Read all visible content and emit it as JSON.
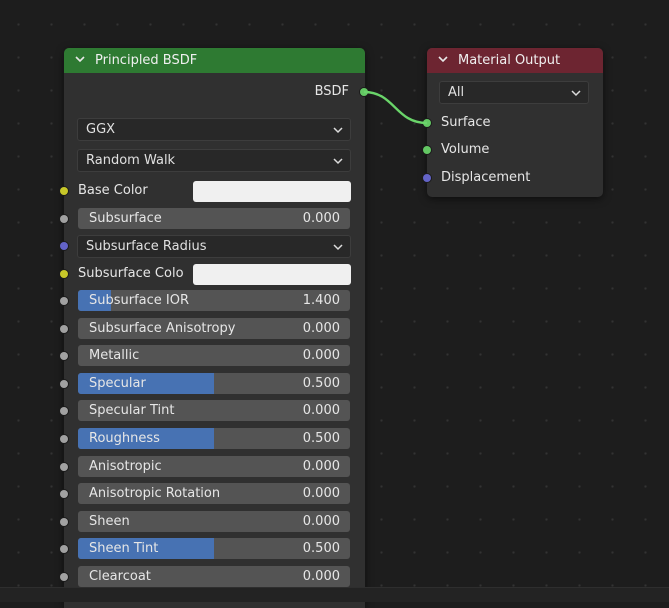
{
  "colors": {
    "bsdf_header": "#2e7a32",
    "output_header": "#6d2531",
    "slider_fill": "#4772b3",
    "slider_bg": "#545454",
    "socket_yellow": "#c7c729",
    "socket_gray": "#a1a1a1",
    "socket_blue": "#6363c7",
    "socket_green": "#63c763",
    "link": "#6ad56a"
  },
  "bsdf_node": {
    "title": "Principled BSDF",
    "output_label": "BSDF",
    "distribution": "GGX",
    "subsurface_method": "Random Walk",
    "base_color_label": "Base Color",
    "base_color_value": "#f0f0f0",
    "subsurface_radius_label": "Subsurface Radius",
    "subsurface_color_label": "Subsurface Colo",
    "subsurface_color_value": "#f0f0f0",
    "sliders": [
      {
        "label": "Subsurface",
        "value": "0.000",
        "fill": 0.0
      },
      {
        "label": "Subsurface IOR",
        "value": "1.400",
        "fill": 0.12
      },
      {
        "label": "Subsurface Anisotropy",
        "value": "0.000",
        "fill": 0.0
      },
      {
        "label": "Metallic",
        "value": "0.000",
        "fill": 0.0
      },
      {
        "label": "Specular",
        "value": "0.500",
        "fill": 0.5
      },
      {
        "label": "Specular Tint",
        "value": "0.000",
        "fill": 0.0
      },
      {
        "label": "Roughness",
        "value": "0.500",
        "fill": 0.5
      },
      {
        "label": "Anisotropic",
        "value": "0.000",
        "fill": 0.0
      },
      {
        "label": "Anisotropic Rotation",
        "value": "0.000",
        "fill": 0.0
      },
      {
        "label": "Sheen",
        "value": "0.000",
        "fill": 0.0
      },
      {
        "label": "Sheen Tint",
        "value": "0.500",
        "fill": 0.5
      },
      {
        "label": "Clearcoat",
        "value": "0.000",
        "fill": 0.0
      }
    ]
  },
  "output_node": {
    "title": "Material Output",
    "target": "All",
    "inputs": [
      "Surface",
      "Volume",
      "Displacement"
    ]
  },
  "icons": {
    "collapse": "chevron-down-icon",
    "dropdown": "chevron-down-icon",
    "socket": "socket-dot-icon"
  }
}
